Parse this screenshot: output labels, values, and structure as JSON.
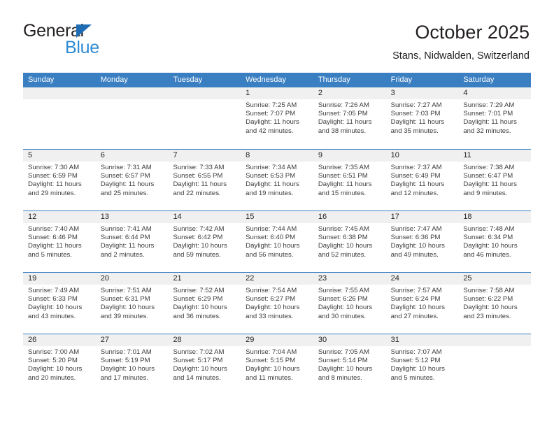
{
  "brand": {
    "name_top": "General",
    "name_bottom": "Blue",
    "triangle_color": "#1f6cb4",
    "blue_color": "#2e8bd4"
  },
  "header": {
    "title": "October 2025",
    "subtitle": "Stans, Nidwalden, Switzerland"
  },
  "theme": {
    "header_blue": "#3a7fc1",
    "daynum_gray": "#f0f0f0",
    "text": "#231f20"
  },
  "weekdays": [
    "Sunday",
    "Monday",
    "Tuesday",
    "Wednesday",
    "Thursday",
    "Friday",
    "Saturday"
  ],
  "labels": {
    "sunrise_prefix": "Sunrise:",
    "sunset_prefix": "Sunset:",
    "daylight_prefix": "Daylight:"
  },
  "weeks": [
    [
      {
        "day": "",
        "empty": true
      },
      {
        "day": "",
        "empty": true
      },
      {
        "day": "",
        "empty": true
      },
      {
        "day": "1",
        "sunrise": "Sunrise: 7:25 AM",
        "sunset": "Sunset: 7:07 PM",
        "daylight_1": "Daylight: 11 hours",
        "daylight_2": "and 42 minutes."
      },
      {
        "day": "2",
        "sunrise": "Sunrise: 7:26 AM",
        "sunset": "Sunset: 7:05 PM",
        "daylight_1": "Daylight: 11 hours",
        "daylight_2": "and 38 minutes."
      },
      {
        "day": "3",
        "sunrise": "Sunrise: 7:27 AM",
        "sunset": "Sunset: 7:03 PM",
        "daylight_1": "Daylight: 11 hours",
        "daylight_2": "and 35 minutes."
      },
      {
        "day": "4",
        "sunrise": "Sunrise: 7:29 AM",
        "sunset": "Sunset: 7:01 PM",
        "daylight_1": "Daylight: 11 hours",
        "daylight_2": "and 32 minutes."
      }
    ],
    [
      {
        "day": "5",
        "sunrise": "Sunrise: 7:30 AM",
        "sunset": "Sunset: 6:59 PM",
        "daylight_1": "Daylight: 11 hours",
        "daylight_2": "and 29 minutes."
      },
      {
        "day": "6",
        "sunrise": "Sunrise: 7:31 AM",
        "sunset": "Sunset: 6:57 PM",
        "daylight_1": "Daylight: 11 hours",
        "daylight_2": "and 25 minutes."
      },
      {
        "day": "7",
        "sunrise": "Sunrise: 7:33 AM",
        "sunset": "Sunset: 6:55 PM",
        "daylight_1": "Daylight: 11 hours",
        "daylight_2": "and 22 minutes."
      },
      {
        "day": "8",
        "sunrise": "Sunrise: 7:34 AM",
        "sunset": "Sunset: 6:53 PM",
        "daylight_1": "Daylight: 11 hours",
        "daylight_2": "and 19 minutes."
      },
      {
        "day": "9",
        "sunrise": "Sunrise: 7:35 AM",
        "sunset": "Sunset: 6:51 PM",
        "daylight_1": "Daylight: 11 hours",
        "daylight_2": "and 15 minutes."
      },
      {
        "day": "10",
        "sunrise": "Sunrise: 7:37 AM",
        "sunset": "Sunset: 6:49 PM",
        "daylight_1": "Daylight: 11 hours",
        "daylight_2": "and 12 minutes."
      },
      {
        "day": "11",
        "sunrise": "Sunrise: 7:38 AM",
        "sunset": "Sunset: 6:47 PM",
        "daylight_1": "Daylight: 11 hours",
        "daylight_2": "and 9 minutes."
      }
    ],
    [
      {
        "day": "12",
        "sunrise": "Sunrise: 7:40 AM",
        "sunset": "Sunset: 6:46 PM",
        "daylight_1": "Daylight: 11 hours",
        "daylight_2": "and 5 minutes."
      },
      {
        "day": "13",
        "sunrise": "Sunrise: 7:41 AM",
        "sunset": "Sunset: 6:44 PM",
        "daylight_1": "Daylight: 11 hours",
        "daylight_2": "and 2 minutes."
      },
      {
        "day": "14",
        "sunrise": "Sunrise: 7:42 AM",
        "sunset": "Sunset: 6:42 PM",
        "daylight_1": "Daylight: 10 hours",
        "daylight_2": "and 59 minutes."
      },
      {
        "day": "15",
        "sunrise": "Sunrise: 7:44 AM",
        "sunset": "Sunset: 6:40 PM",
        "daylight_1": "Daylight: 10 hours",
        "daylight_2": "and 56 minutes."
      },
      {
        "day": "16",
        "sunrise": "Sunrise: 7:45 AM",
        "sunset": "Sunset: 6:38 PM",
        "daylight_1": "Daylight: 10 hours",
        "daylight_2": "and 52 minutes."
      },
      {
        "day": "17",
        "sunrise": "Sunrise: 7:47 AM",
        "sunset": "Sunset: 6:36 PM",
        "daylight_1": "Daylight: 10 hours",
        "daylight_2": "and 49 minutes."
      },
      {
        "day": "18",
        "sunrise": "Sunrise: 7:48 AM",
        "sunset": "Sunset: 6:34 PM",
        "daylight_1": "Daylight: 10 hours",
        "daylight_2": "and 46 minutes."
      }
    ],
    [
      {
        "day": "19",
        "sunrise": "Sunrise: 7:49 AM",
        "sunset": "Sunset: 6:33 PM",
        "daylight_1": "Daylight: 10 hours",
        "daylight_2": "and 43 minutes."
      },
      {
        "day": "20",
        "sunrise": "Sunrise: 7:51 AM",
        "sunset": "Sunset: 6:31 PM",
        "daylight_1": "Daylight: 10 hours",
        "daylight_2": "and 39 minutes."
      },
      {
        "day": "21",
        "sunrise": "Sunrise: 7:52 AM",
        "sunset": "Sunset: 6:29 PM",
        "daylight_1": "Daylight: 10 hours",
        "daylight_2": "and 36 minutes."
      },
      {
        "day": "22",
        "sunrise": "Sunrise: 7:54 AM",
        "sunset": "Sunset: 6:27 PM",
        "daylight_1": "Daylight: 10 hours",
        "daylight_2": "and 33 minutes."
      },
      {
        "day": "23",
        "sunrise": "Sunrise: 7:55 AM",
        "sunset": "Sunset: 6:26 PM",
        "daylight_1": "Daylight: 10 hours",
        "daylight_2": "and 30 minutes."
      },
      {
        "day": "24",
        "sunrise": "Sunrise: 7:57 AM",
        "sunset": "Sunset: 6:24 PM",
        "daylight_1": "Daylight: 10 hours",
        "daylight_2": "and 27 minutes."
      },
      {
        "day": "25",
        "sunrise": "Sunrise: 7:58 AM",
        "sunset": "Sunset: 6:22 PM",
        "daylight_1": "Daylight: 10 hours",
        "daylight_2": "and 23 minutes."
      }
    ],
    [
      {
        "day": "26",
        "sunrise": "Sunrise: 7:00 AM",
        "sunset": "Sunset: 5:20 PM",
        "daylight_1": "Daylight: 10 hours",
        "daylight_2": "and 20 minutes."
      },
      {
        "day": "27",
        "sunrise": "Sunrise: 7:01 AM",
        "sunset": "Sunset: 5:19 PM",
        "daylight_1": "Daylight: 10 hours",
        "daylight_2": "and 17 minutes."
      },
      {
        "day": "28",
        "sunrise": "Sunrise: 7:02 AM",
        "sunset": "Sunset: 5:17 PM",
        "daylight_1": "Daylight: 10 hours",
        "daylight_2": "and 14 minutes."
      },
      {
        "day": "29",
        "sunrise": "Sunrise: 7:04 AM",
        "sunset": "Sunset: 5:15 PM",
        "daylight_1": "Daylight: 10 hours",
        "daylight_2": "and 11 minutes."
      },
      {
        "day": "30",
        "sunrise": "Sunrise: 7:05 AM",
        "sunset": "Sunset: 5:14 PM",
        "daylight_1": "Daylight: 10 hours",
        "daylight_2": "and 8 minutes."
      },
      {
        "day": "31",
        "sunrise": "Sunrise: 7:07 AM",
        "sunset": "Sunset: 5:12 PM",
        "daylight_1": "Daylight: 10 hours",
        "daylight_2": "and 5 minutes."
      },
      {
        "day": "",
        "empty": true
      }
    ]
  ]
}
